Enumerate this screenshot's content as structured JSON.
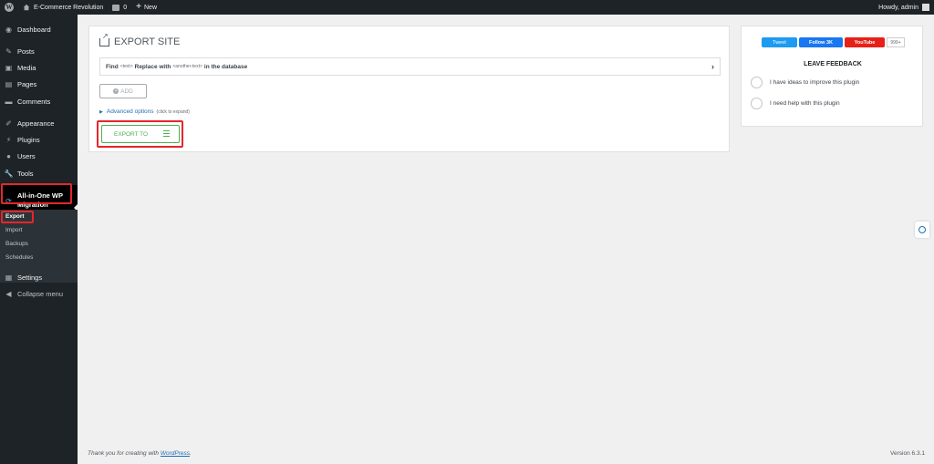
{
  "adminbar": {
    "site_name": "E-Commerce Revolution",
    "comments_count": "0",
    "new_label": "New",
    "greeting": "Howdy, admin"
  },
  "sidebar": {
    "items": [
      {
        "label": "Dashboard",
        "icon": "dashboard-icon"
      },
      {
        "label": "Posts",
        "icon": "pin-icon"
      },
      {
        "label": "Media",
        "icon": "media-icon"
      },
      {
        "label": "Pages",
        "icon": "pages-icon"
      },
      {
        "label": "Comments",
        "icon": "comments-icon"
      },
      {
        "label": "Appearance",
        "icon": "brush-icon"
      },
      {
        "label": "Plugins",
        "icon": "plug-icon"
      },
      {
        "label": "Users",
        "icon": "users-icon"
      },
      {
        "label": "Tools",
        "icon": "wrench-icon"
      },
      {
        "label": "All-in-One WP Migration",
        "line1": "All-in-One WP",
        "line2": "Migration",
        "icon": "migration-icon"
      },
      {
        "label": "Settings",
        "icon": "settings-icon"
      },
      {
        "label": "Collapse menu",
        "icon": "collapse-icon"
      }
    ],
    "submenu": [
      "Export",
      "Import",
      "Backups",
      "Schedules"
    ]
  },
  "export": {
    "title": "EXPORT SITE",
    "find_label": "Find",
    "find_placeholder": "<text>",
    "replace_label": "Replace with",
    "replace_placeholder": "<another-text>",
    "db_label": "in the database",
    "add_label": "ADD",
    "advanced_label": "Advanced options",
    "advanced_hint": "(click to expand)",
    "export_to_label": "EXPORT TO"
  },
  "feedback": {
    "tweet": "Tweet",
    "follow": "Follow 3K",
    "youtube": "YouTube",
    "youtube_count": "999+",
    "title": "LEAVE FEEDBACK",
    "options": [
      "I have ideas to improve this plugin",
      "I need help with this plugin"
    ]
  },
  "footer": {
    "thanks_prefix": "Thank you for creating with",
    "wp_link": "WordPress",
    "thanks_suffix": ".",
    "version": "Version 6.3.1"
  },
  "colors": {
    "admin_dark": "#1d2327",
    "highlight_red": "#e5262b",
    "export_green": "#4caf50",
    "link_blue": "#2271b1"
  }
}
